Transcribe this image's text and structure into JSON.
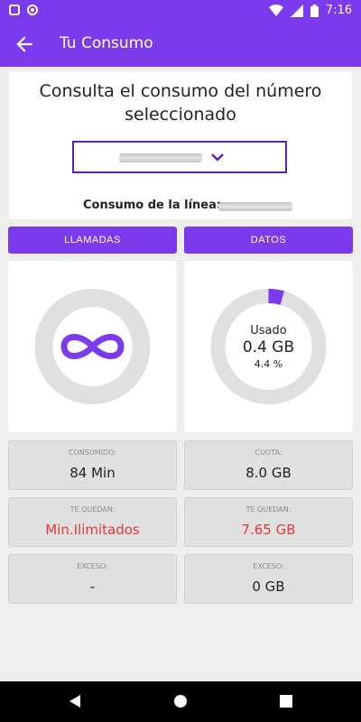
{
  "status_bar": {
    "time": "7:16"
  },
  "app_bar": {
    "title": "Tu Consumo"
  },
  "consulta": {
    "heading": "Consulta el consumo del número seleccionado",
    "consumo_label": "Consumo de la línea:"
  },
  "tabs": [
    {
      "label": "LLAMADAS"
    },
    {
      "label": "DATOS"
    }
  ],
  "datos_gauge": {
    "label": "Usado",
    "value": "0.4 GB",
    "percent_label": "4.4 %",
    "fraction": 0.044
  },
  "colors": {
    "primary": "#7c3aed",
    "accent_red": "#e53935",
    "track": "#e0e0e0"
  },
  "llamadas_cards": [
    {
      "label": "CONSUMIDO:",
      "value": "84 Min"
    },
    {
      "label": "TE QUEDAN:",
      "value": "Min.Ilimitados"
    },
    {
      "label": "EXCESO:",
      "value": "-"
    }
  ],
  "datos_cards": [
    {
      "label": "CUOTA:",
      "value": "8.0 GB"
    },
    {
      "label": "TE QUEDAN:",
      "value": "7.65 GB"
    },
    {
      "label": "EXCESO:",
      "value": "0 GB"
    }
  ]
}
